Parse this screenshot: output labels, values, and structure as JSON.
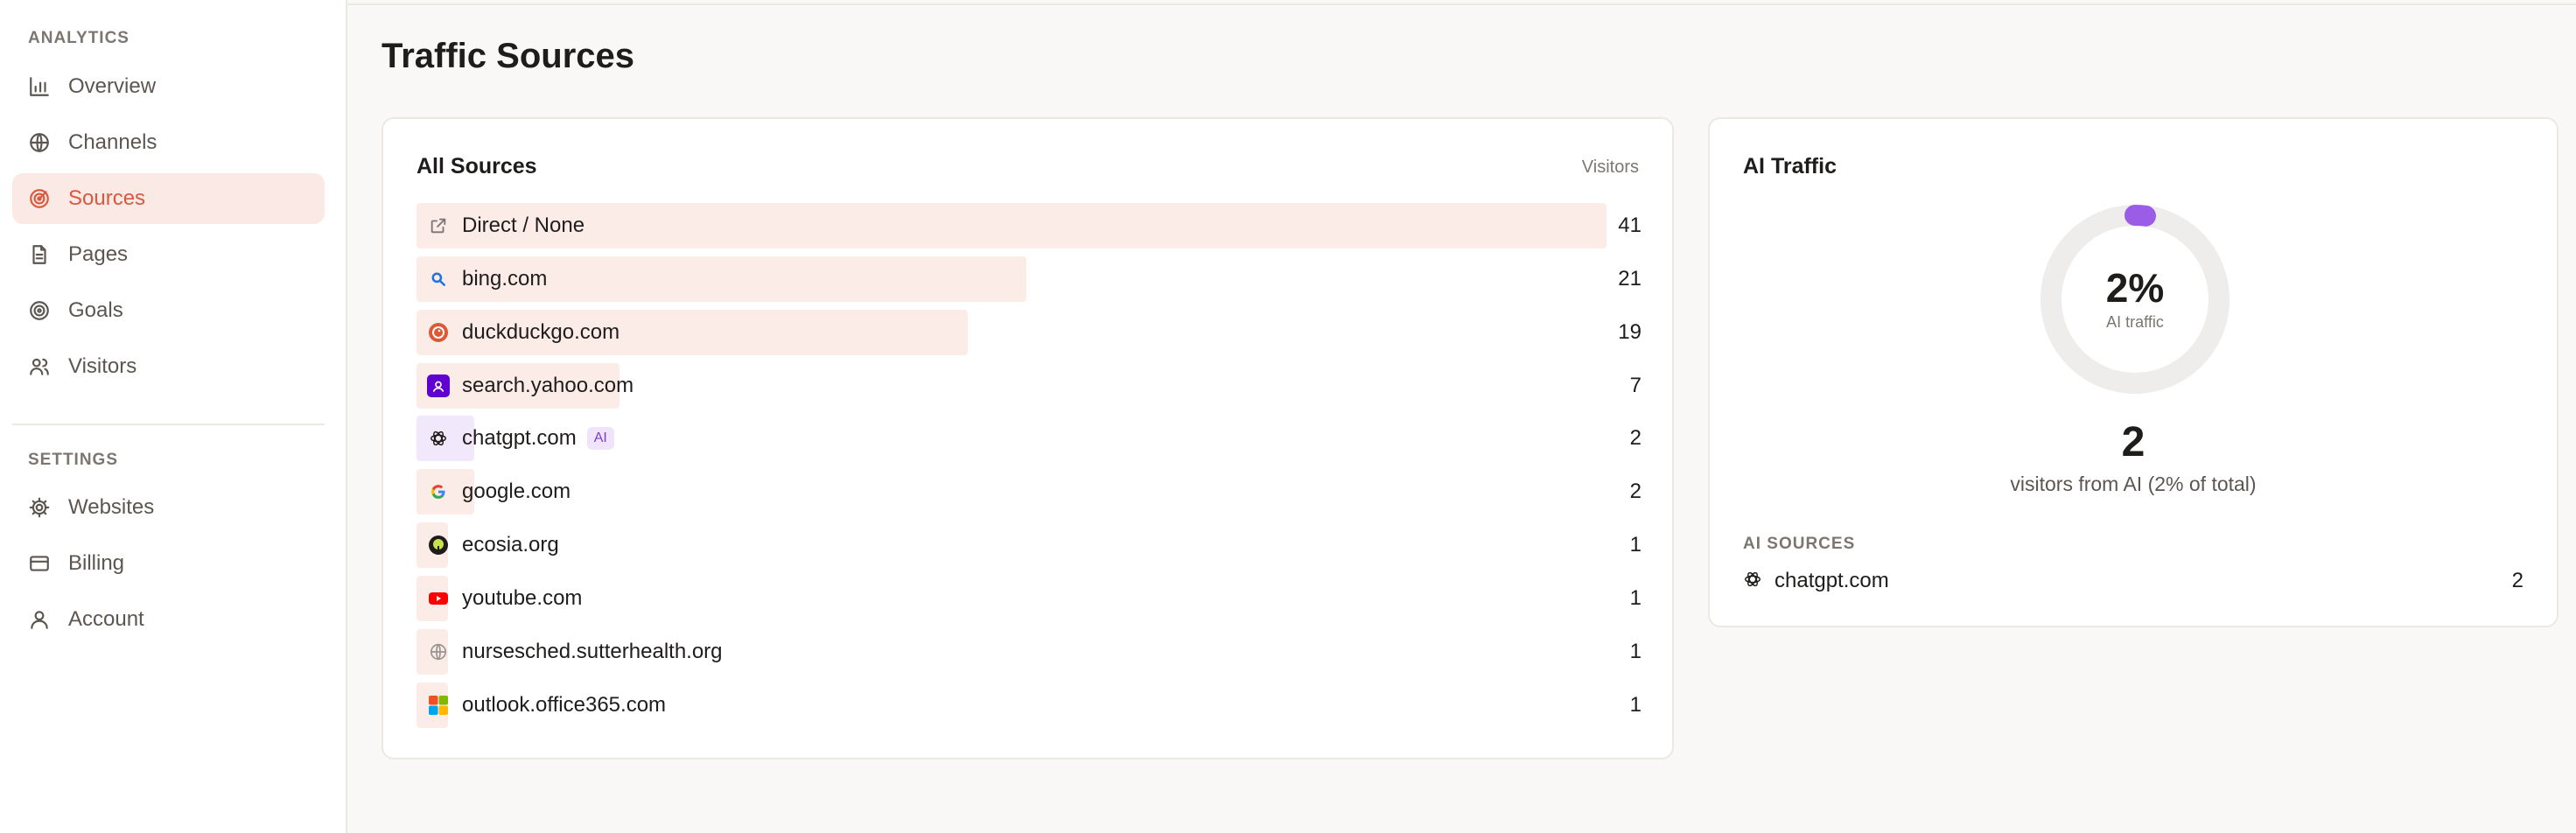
{
  "sidebar": {
    "analytics_label": "ANALYTICS",
    "analytics_items": [
      {
        "label": "Overview",
        "icon": "bar-chart-icon"
      },
      {
        "label": "Channels",
        "icon": "globe-icon"
      },
      {
        "label": "Sources",
        "icon": "target-icon",
        "active": true
      },
      {
        "label": "Pages",
        "icon": "document-icon"
      },
      {
        "label": "Goals",
        "icon": "bullseye-icon"
      },
      {
        "label": "Visitors",
        "icon": "users-icon"
      }
    ],
    "settings_label": "SETTINGS",
    "settings_items": [
      {
        "label": "Websites",
        "icon": "gear-icon"
      },
      {
        "label": "Billing",
        "icon": "credit-card-icon"
      },
      {
        "label": "Account",
        "icon": "user-icon"
      }
    ]
  },
  "page": {
    "title": "Traffic Sources"
  },
  "sources": {
    "title": "All Sources",
    "column_header": "Visitors",
    "rows": [
      {
        "label": "Direct / None",
        "count": "41",
        "icon": "external-link-icon"
      },
      {
        "label": "bing.com",
        "count": "21",
        "icon": "bing-icon"
      },
      {
        "label": "duckduckgo.com",
        "count": "19",
        "icon": "duckduckgo-icon"
      },
      {
        "label": "search.yahoo.com",
        "count": "7",
        "icon": "yahoo-icon"
      },
      {
        "label": "chatgpt.com",
        "count": "2",
        "icon": "chatgpt-icon",
        "badge": "AI"
      },
      {
        "label": "google.com",
        "count": "2",
        "icon": "google-icon"
      },
      {
        "label": "ecosia.org",
        "count": "1",
        "icon": "ecosia-icon"
      },
      {
        "label": "youtube.com",
        "count": "1",
        "icon": "youtube-icon"
      },
      {
        "label": "nursesched.sutterhealth.org",
        "count": "1",
        "icon": "globe-icon"
      },
      {
        "label": "outlook.office365.com",
        "count": "1",
        "icon": "office365-icon"
      }
    ]
  },
  "ai_traffic": {
    "title": "AI Traffic",
    "percent": "2%",
    "percent_value": 0.02,
    "percent_caption": "AI traffic",
    "count": "2",
    "description": "visitors from AI (2% of total)",
    "sources_label": "AI SOURCES",
    "sources": [
      {
        "label": "chatgpt.com",
        "count": "2",
        "icon": "chatgpt-icon"
      }
    ]
  },
  "colors": {
    "accent": "#d9583e",
    "accent_bg": "#fbe9e5",
    "ai_purple": "#9b5de5",
    "ring_track": "#efedeb"
  }
}
